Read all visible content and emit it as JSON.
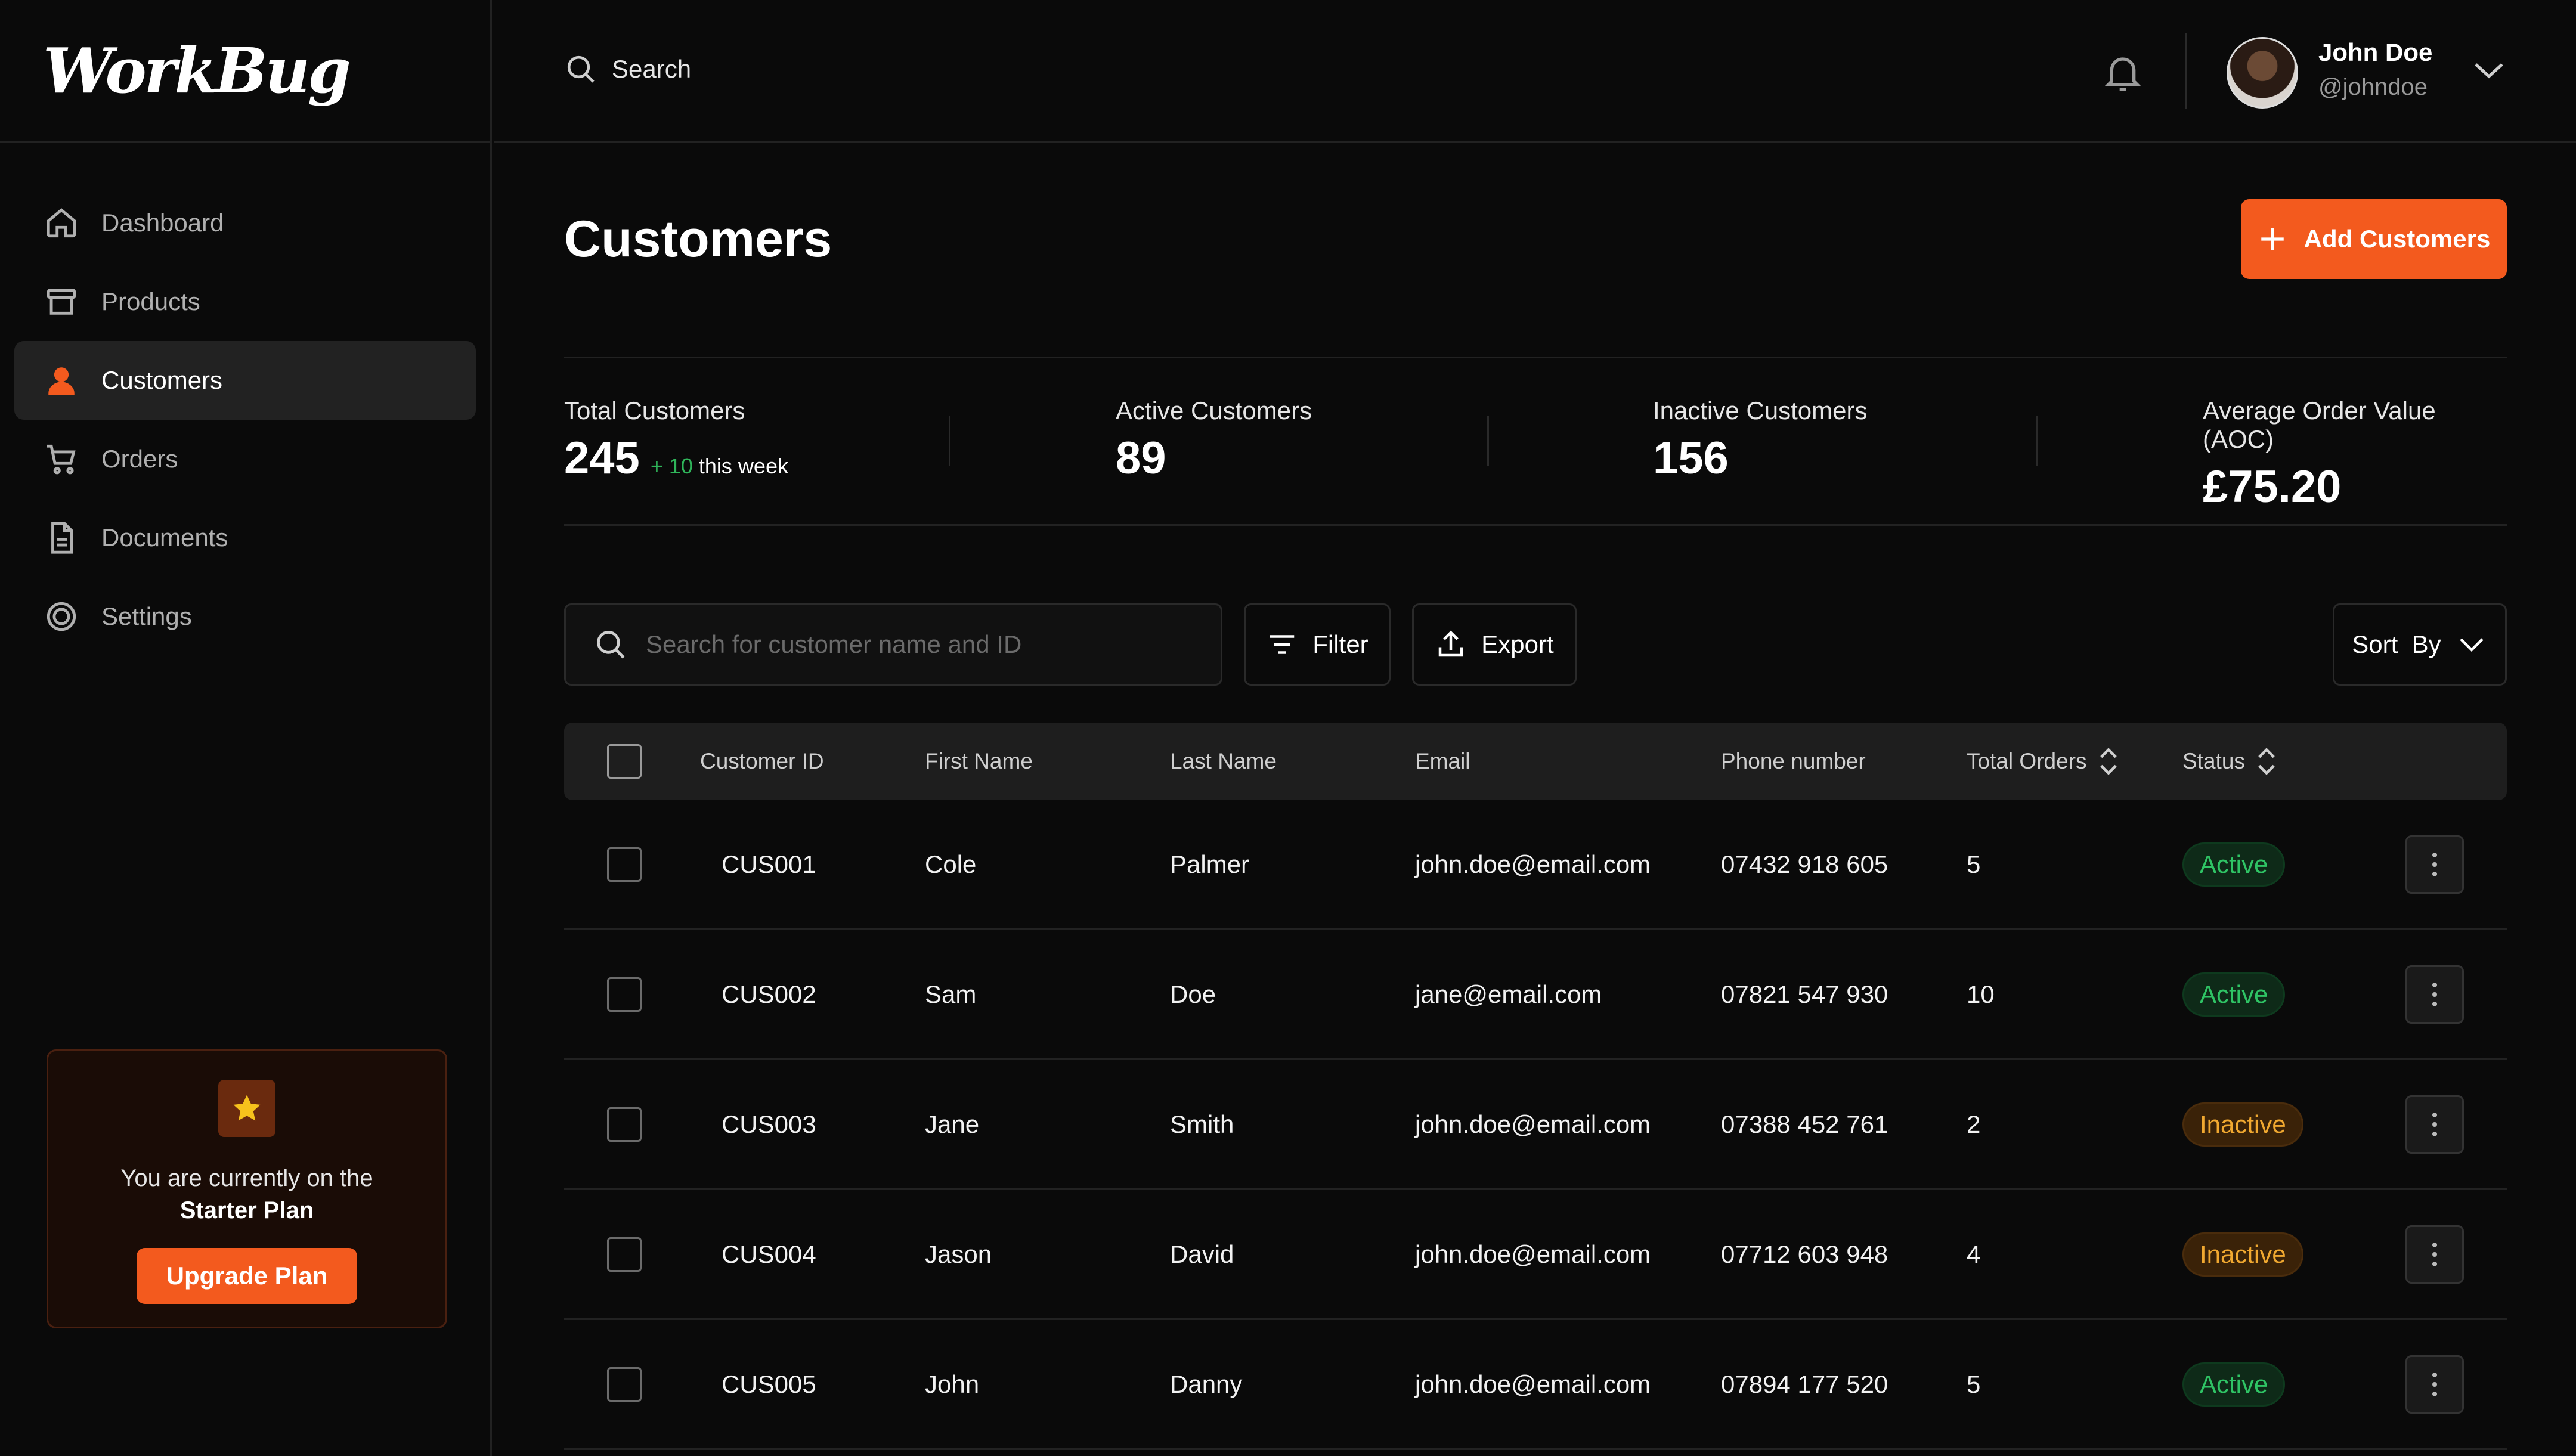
{
  "app": {
    "logo": "WorkBug"
  },
  "sidebar": {
    "items": [
      {
        "label": "Dashboard",
        "icon": "home-icon"
      },
      {
        "label": "Products",
        "icon": "box-icon"
      },
      {
        "label": "Customers",
        "icon": "user-icon",
        "active": true
      },
      {
        "label": "Orders",
        "icon": "cart-icon"
      },
      {
        "label": "Documents",
        "icon": "document-icon"
      },
      {
        "label": "Settings",
        "icon": "gear-icon"
      }
    ],
    "plan": {
      "text": "You are currently on the",
      "name": "Starter Plan",
      "button": "Upgrade Plan"
    }
  },
  "header": {
    "search_label": "Search",
    "user": {
      "name": "John Doe",
      "handle": "@johndoe"
    }
  },
  "page": {
    "title": "Customers",
    "add_button": "Add Customers"
  },
  "stats": [
    {
      "label": "Total Customers",
      "value": "245",
      "delta_up": "+ 10",
      "delta_text": "this week"
    },
    {
      "label": "Active Customers",
      "value": "89"
    },
    {
      "label": "Inactive Customers",
      "value": "156"
    },
    {
      "label": "Average Order Value (AOC)",
      "value": "£75.20"
    }
  ],
  "toolbar": {
    "search_placeholder": "Search for customer name and ID",
    "filter": "Filter",
    "export": "Export",
    "sort": "Sort  By"
  },
  "table": {
    "columns": [
      "Customer ID",
      "First Name",
      "Last Name",
      "Email",
      "Phone number",
      "Total Orders",
      "Status"
    ],
    "rows": [
      {
        "id": "CUS001",
        "first": "Cole",
        "last": "Palmer",
        "email": "john.doe@email.com",
        "phone": "07432 918 605",
        "orders": "5",
        "status": "Active"
      },
      {
        "id": "CUS002",
        "first": "Sam",
        "last": "Doe",
        "email": "jane@email.com",
        "phone": "07821 547 930",
        "orders": "10",
        "status": "Active"
      },
      {
        "id": "CUS003",
        "first": "Jane",
        "last": "Smith",
        "email": "john.doe@email.com",
        "phone": "07388 452 761",
        "orders": "2",
        "status": "Inactive"
      },
      {
        "id": "CUS004",
        "first": "Jason",
        "last": "David",
        "email": "john.doe@email.com",
        "phone": "07712 603 948",
        "orders": "4",
        "status": "Inactive"
      },
      {
        "id": "CUS005",
        "first": "John",
        "last": "Danny",
        "email": "john.doe@email.com",
        "phone": "07894 177 520",
        "orders": "5",
        "status": "Active"
      }
    ]
  },
  "colors": {
    "accent": "#f35a1e",
    "active": "#2fc465",
    "inactive": "#f0a830",
    "background": "#0a0a0a"
  }
}
